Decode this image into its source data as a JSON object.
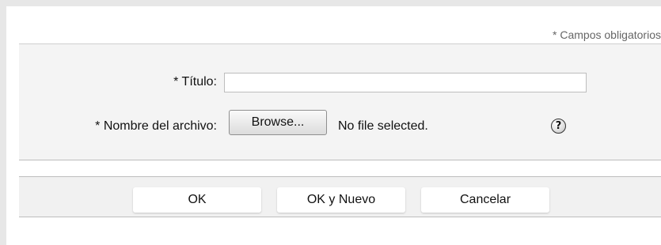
{
  "form": {
    "required_note": "* Campos obligatorios",
    "title_label": "* Título:",
    "title_value": "",
    "file_label": "* Nombre del archivo:",
    "browse_label": "Browse...",
    "file_status": "No file selected.",
    "help_icon": "?"
  },
  "actions": {
    "ok": "OK",
    "ok_new": "OK y Nuevo",
    "cancel": "Cancelar"
  }
}
